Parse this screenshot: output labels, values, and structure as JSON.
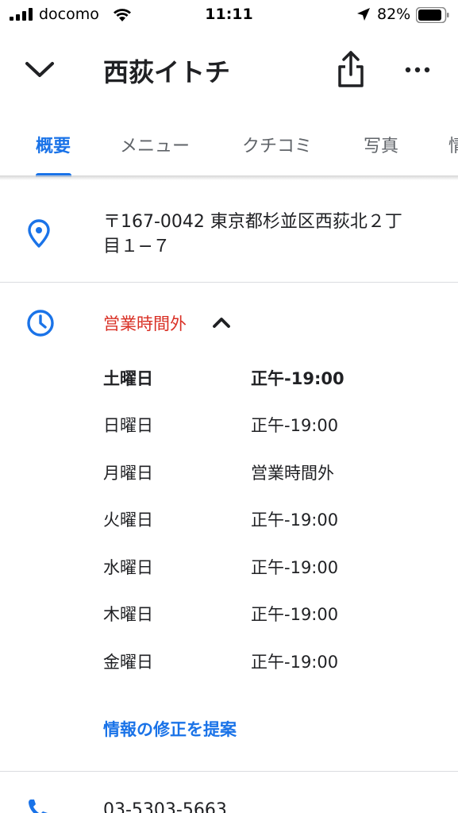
{
  "status_bar": {
    "carrier": "docomo",
    "time": "11:11",
    "battery_percent": "82%",
    "icons": [
      "signal-icon",
      "wifi-icon",
      "location-arrow-icon",
      "battery-icon"
    ]
  },
  "header": {
    "title": "西荻イトチ",
    "icons": [
      "chevron-down-icon",
      "share-icon",
      "more-icon"
    ]
  },
  "tabs": [
    {
      "label": "概要",
      "active": true
    },
    {
      "label": "メニュー",
      "active": false
    },
    {
      "label": "クチコミ",
      "active": false
    },
    {
      "label": "写真",
      "active": false
    },
    {
      "label": "情",
      "active": false
    }
  ],
  "address": {
    "line1": "〒167-0042 東京都杉並区西荻北２丁",
    "line2": "目１−７",
    "icon": "location-pin-icon"
  },
  "hours": {
    "status": "営業時間外",
    "icon": "clock-icon",
    "rows": [
      {
        "day": "土曜日",
        "time": "正午-19:00",
        "current": true
      },
      {
        "day": "日曜日",
        "time": "正午-19:00",
        "current": false
      },
      {
        "day": "月曜日",
        "time": "営業時間外",
        "current": false
      },
      {
        "day": "火曜日",
        "time": "正午-19:00",
        "current": false
      },
      {
        "day": "水曜日",
        "time": "正午-19:00",
        "current": false
      },
      {
        "day": "木曜日",
        "time": "正午-19:00",
        "current": false
      },
      {
        "day": "金曜日",
        "time": "正午-19:00",
        "current": false
      }
    ],
    "suggest_edit": "情報の修正を提案"
  },
  "phone": {
    "number": "03-5303-5663",
    "icon": "phone-icon"
  },
  "colors": {
    "accent": "#1a73e8",
    "closed": "#d93025",
    "text": "#202124",
    "muted": "#5f6368",
    "divider": "#dadce0"
  }
}
